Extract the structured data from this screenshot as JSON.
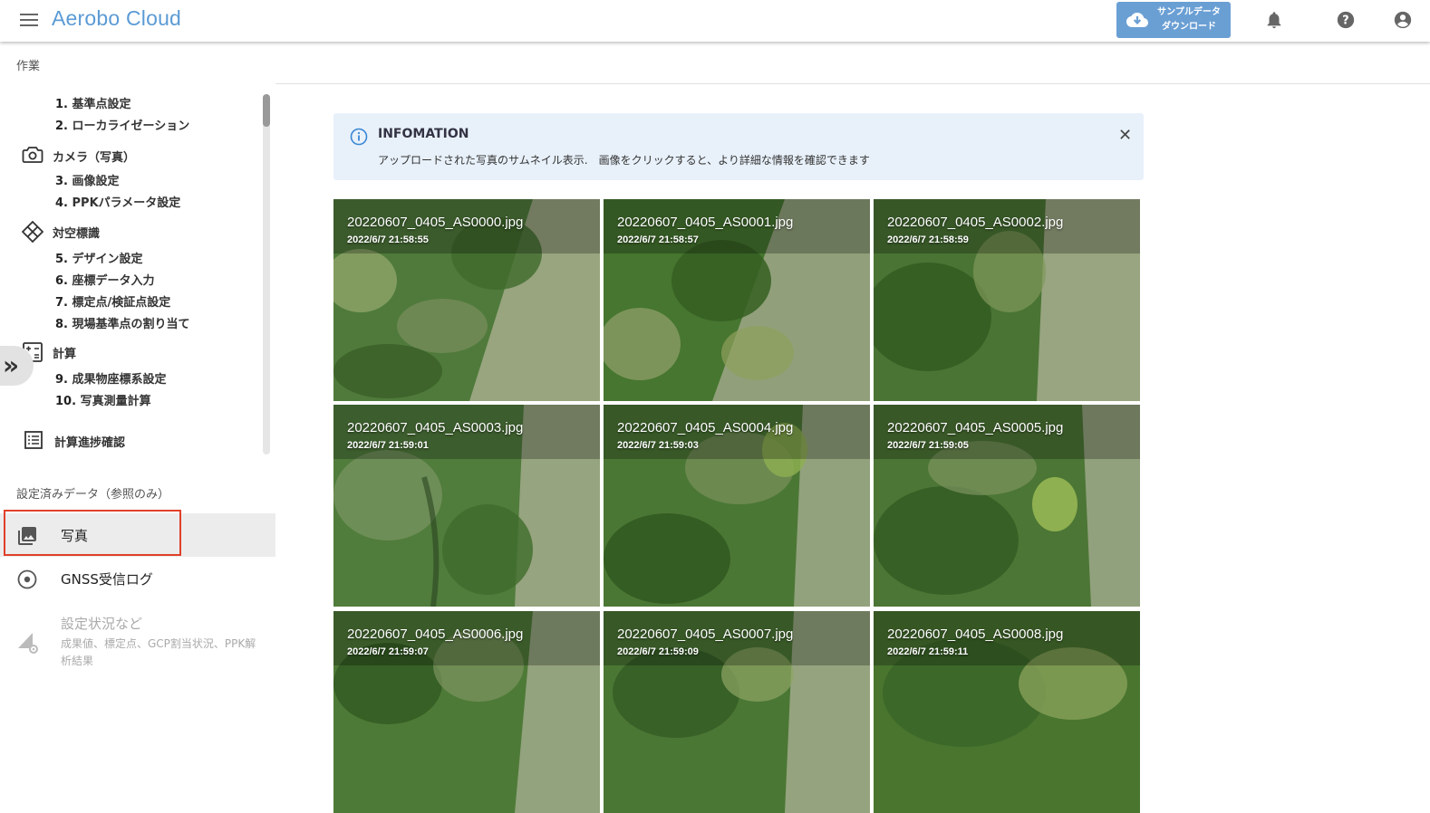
{
  "header": {
    "title": "Aerobo Cloud",
    "download_line1": "サンプルデータ",
    "download_line2": "ダウンロード",
    "icons": [
      "menu-icon",
      "cloud-download-icon",
      "bell-icon",
      "help-icon",
      "account-icon"
    ],
    "accent_color": "#6a9fd4"
  },
  "sidebar": {
    "section_work": "作業",
    "steps_top": [
      {
        "num": "1.",
        "label": "基準点設定"
      },
      {
        "num": "2.",
        "label": "ローカライゼーション"
      }
    ],
    "group_camera": "カメラ（写真）",
    "steps_camera": [
      {
        "num": "3.",
        "label": "画像設定"
      },
      {
        "num": "4.",
        "label": "PPKパラメータ設定"
      }
    ],
    "group_target": "対空標識",
    "steps_target": [
      {
        "num": "5.",
        "label": "デザイン設定"
      },
      {
        "num": "6.",
        "label": "座標データ入力"
      },
      {
        "num": "7.",
        "label": "標定点/検証点設定"
      },
      {
        "num": "8.",
        "label": "現場基準点の割り当て"
      }
    ],
    "group_calc": "計算",
    "steps_calc": [
      {
        "num": "9.",
        "label": "成果物座標系設定"
      },
      {
        "num": "10.",
        "label": "写真測量計算"
      }
    ],
    "progress_label": "計算進捗確認",
    "section_ref": "設定済みデータ（参照のみ）",
    "nav_photo": "写真",
    "nav_gnss": "GNSS受信ログ",
    "nav_settings": "設定状況など",
    "nav_settings_sub": "成果値、標定点、GCP割当状況、PPK解析結果",
    "collapse_glyph": "»"
  },
  "info": {
    "title": "INFOMATION",
    "text": "アップロードされた写真のサムネイル表示.　画像をクリックすると、より詳細な情報を確認できます",
    "close_glyph": "✕"
  },
  "photos": [
    {
      "name": "20220607_0405_AS0000.jpg",
      "date": "2022/6/7 21:58:55"
    },
    {
      "name": "20220607_0405_AS0001.jpg",
      "date": "2022/6/7 21:58:57"
    },
    {
      "name": "20220607_0405_AS0002.jpg",
      "date": "2022/6/7 21:58:59"
    },
    {
      "name": "20220607_0405_AS0003.jpg",
      "date": "2022/6/7 21:59:01"
    },
    {
      "name": "20220607_0405_AS0004.jpg",
      "date": "2022/6/7 21:59:03"
    },
    {
      "name": "20220607_0405_AS0005.jpg",
      "date": "2022/6/7 21:59:05"
    },
    {
      "name": "20220607_0405_AS0006.jpg",
      "date": "2022/6/7 21:59:07"
    },
    {
      "name": "20220607_0405_AS0007.jpg",
      "date": "2022/6/7 21:59:09"
    },
    {
      "name": "20220607_0405_AS0008.jpg",
      "date": "2022/6/7 21:59:11"
    }
  ]
}
